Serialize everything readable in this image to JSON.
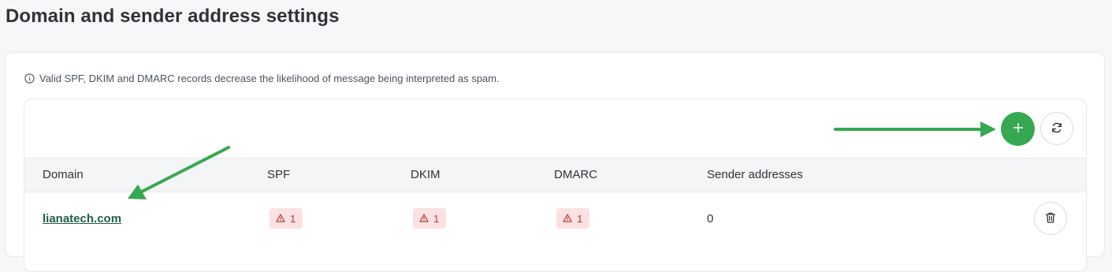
{
  "page": {
    "title": "Domain and sender address settings"
  },
  "info": {
    "icon": "info-icon",
    "text": "Valid SPF, DKIM and DMARC records decrease the likelihood of message being interpreted as spam."
  },
  "toolbar": {
    "add_icon": "plus-icon",
    "refresh_icon": "refresh-icon"
  },
  "table": {
    "columns": [
      "Domain",
      "SPF",
      "DKIM",
      "DMARC",
      "Sender addresses"
    ],
    "rows": [
      {
        "domain": "lianatech.com",
        "spf": "1",
        "dkim": "1",
        "dmarc": "1",
        "sender_addresses": "0",
        "status_icon": "warning-icon",
        "delete_icon": "trash-icon"
      }
    ]
  },
  "colors": {
    "accent_green": "#36a852",
    "link_green": "#1f5f46",
    "warning_bg": "#fbe1e1",
    "warning_fg": "#b33a3a"
  },
  "annotations": {
    "arrow_color": "#36a852"
  }
}
